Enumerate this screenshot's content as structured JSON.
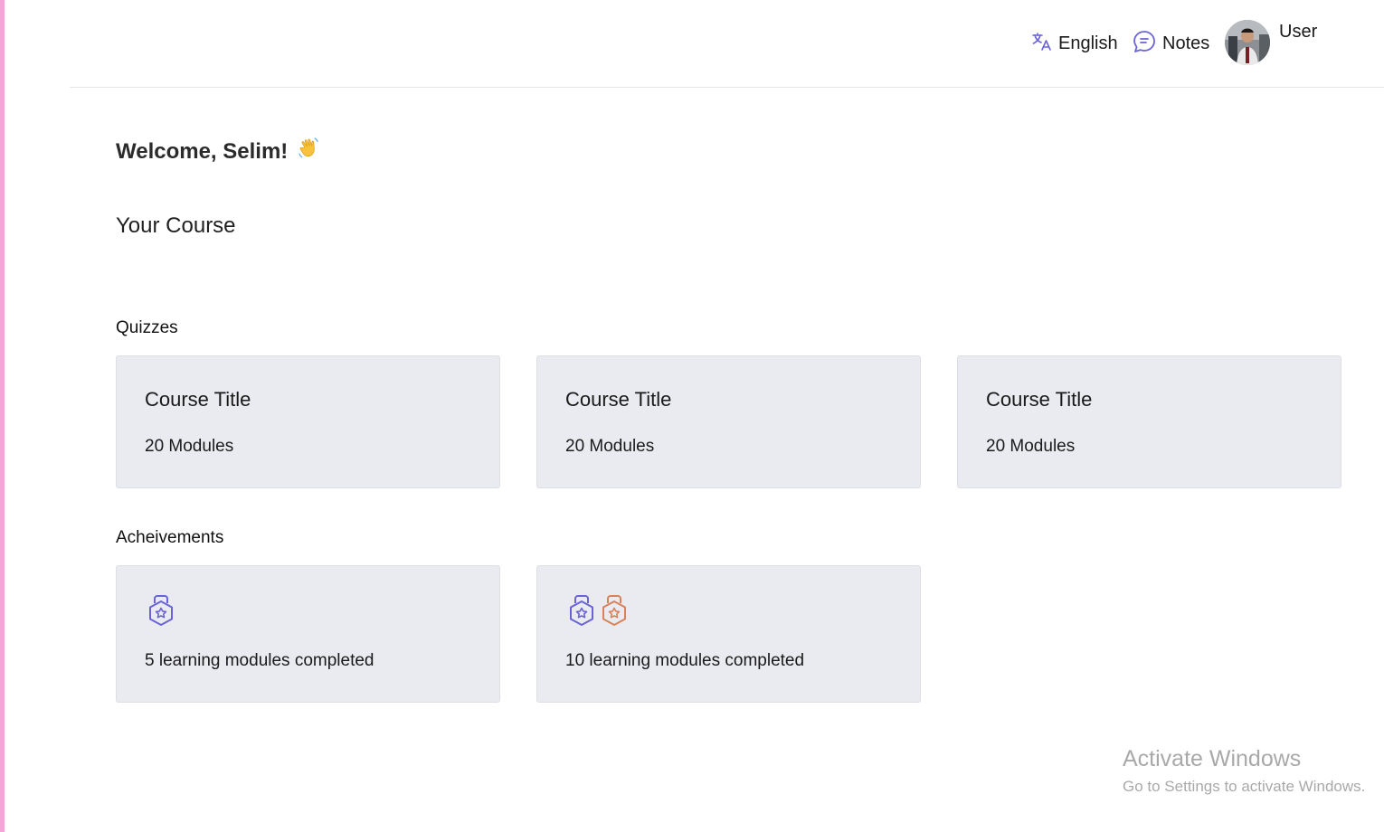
{
  "header": {
    "language_label": "English",
    "notes_label": "Notes",
    "user_label": "User"
  },
  "welcome": {
    "text": "Welcome, Selim!",
    "emoji_icon": "waving-hand-icon"
  },
  "section_title": "Your Course",
  "quizzes": {
    "label": "Quizzes",
    "cards": [
      {
        "title": "Course Title",
        "modules": "20 Modules"
      },
      {
        "title": "Course Title",
        "modules": "20 Modules"
      },
      {
        "title": "Course Title",
        "modules": "20 Modules"
      }
    ]
  },
  "achievements": {
    "label": "Acheivements",
    "cards": [
      {
        "text": "5 learning modules completed",
        "badges": [
          "badge-purple-icon"
        ]
      },
      {
        "text": "10 learning modules completed",
        "badges": [
          "badge-purple-icon",
          "badge-orange-icon"
        ]
      }
    ]
  },
  "watermark": {
    "title": "Activate Windows",
    "subtitle": "Go to Settings to activate Windows."
  },
  "colors": {
    "accent_purple": "#6a63d8",
    "badge_orange": "#d9825a",
    "card_bg": "#eaebf0",
    "left_accent": "#f0a8d8"
  }
}
